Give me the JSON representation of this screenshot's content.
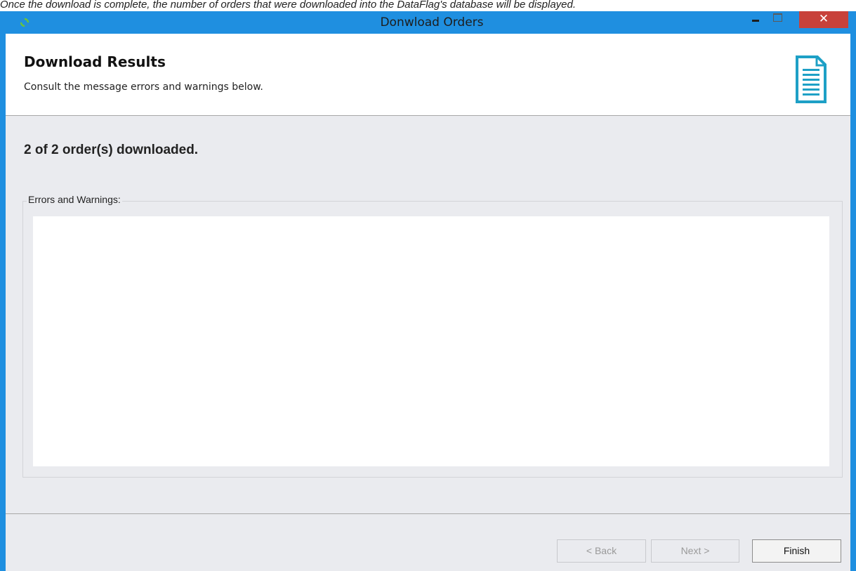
{
  "caption": "Once the download is complete, the number of orders that were downloaded into the DataFlag's database will be displayed.",
  "window": {
    "title": "Donwload Orders",
    "close_glyph": "✕",
    "icons": {
      "app": "refresh-icon",
      "document": "document-icon"
    }
  },
  "header": {
    "title": "Download Results",
    "subtitle": "Consult the message errors and warnings below."
  },
  "summary": "2 of 2 order(s) downloaded.",
  "errors_group": {
    "label": "Errors and Warnings:"
  },
  "buttons": {
    "back": "< Back",
    "next": "Next >",
    "finish": "Finish"
  },
  "colors": {
    "frame": "#1f8fe0",
    "close": "#c8413a",
    "accent_icon": "#1ea0c6"
  }
}
